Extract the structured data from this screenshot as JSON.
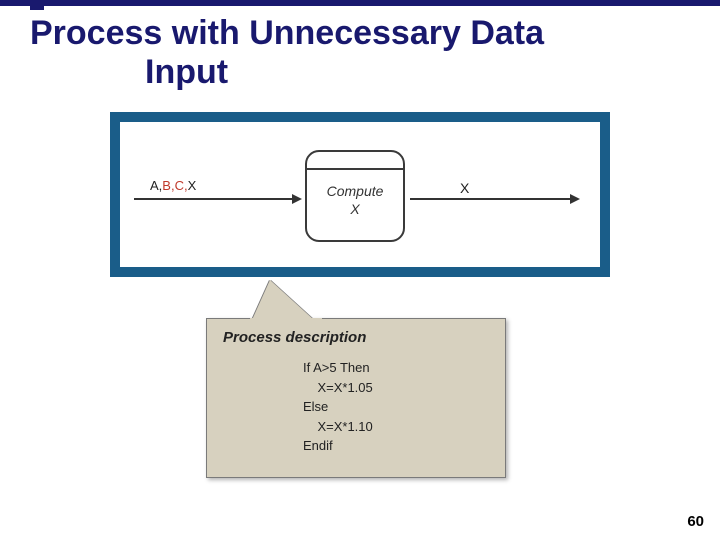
{
  "title_line1": "Process with Unnecessary Data",
  "title_line2": "Input",
  "process": {
    "name_line1": "Compute",
    "name_line2": "X"
  },
  "input_label": {
    "a": "A,",
    "bc": "B,C,",
    "x": "X"
  },
  "output_label": "X",
  "callout": {
    "heading": "Process description",
    "code": "If A>5 Then\n    X=X*1.05\nElse\n    X=X*1.10\nEndif"
  },
  "page_number": "60"
}
